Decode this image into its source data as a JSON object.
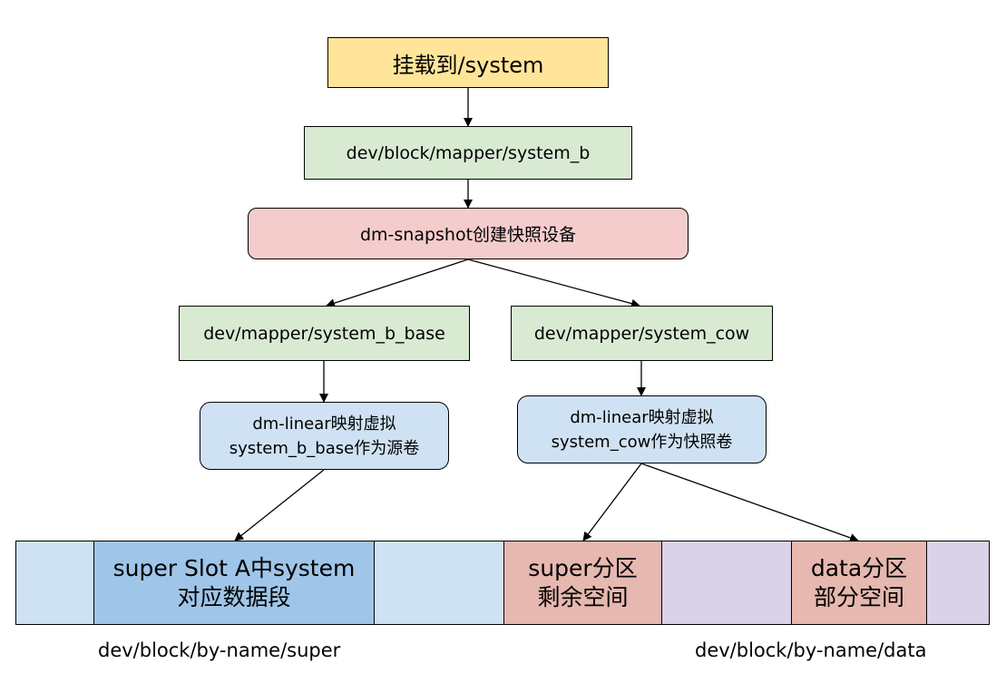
{
  "nodes": {
    "mount": "挂载到/system",
    "mapper_system_b": "dev/block/mapper/system_b",
    "snapshot": "dm-snapshot创建快照设备",
    "system_b_base": "dev/mapper/system_b_base",
    "system_cow": "dev/mapper/system_cow",
    "linear_base": {
      "line1": "dm-linear映射虚拟",
      "line2": "system_b_base作为源卷"
    },
    "linear_cow": {
      "line1": "dm-linear映射虚拟",
      "line2": "system_cow作为快照卷"
    }
  },
  "segments": {
    "super_slot_a": {
      "line1": "super Slot A中system",
      "line2": "对应数据段"
    },
    "super_remaining": {
      "line1": "super分区",
      "line2": "剩余空间"
    },
    "data_part": {
      "line1": "data分区",
      "line2": "部分空间"
    }
  },
  "labels": {
    "super": "dev/block/by-name/super",
    "data": "dev/block/by-name/data"
  },
  "colors": {
    "yellow": "#ffe599",
    "green": "#d9ead3",
    "pink": "#f4cccc",
    "light_blue": "#cfe2f3",
    "mid_blue": "#9fc5e8",
    "salmon": "#e6b8af",
    "lavender": "#d9d2e9"
  }
}
